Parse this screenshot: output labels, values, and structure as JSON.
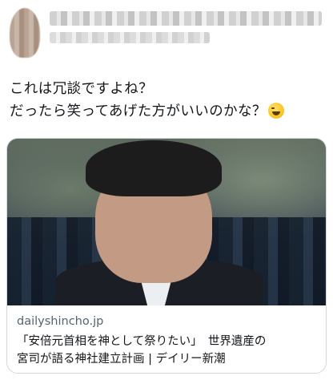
{
  "tweet": {
    "text_line1": "これは冗談ですよね？",
    "text_line2": "だったら笑ってあげた方がいいのかな？",
    "emoji_name": "grinning-sweat-emoji"
  },
  "link_card": {
    "domain": "dailyshincho.jp",
    "title_line1": "「安倍元首相を神として祭りたい」　世界遺産の",
    "title_line2": "宮司が語る神社建立計画 | デイリー新潮"
  }
}
